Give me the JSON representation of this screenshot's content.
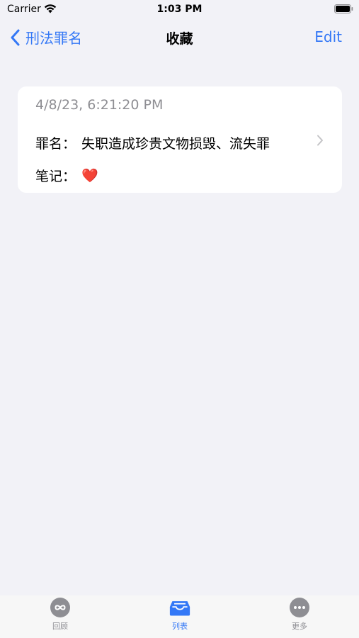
{
  "status_bar": {
    "carrier": "Carrier",
    "time": "1:03 PM",
    "icons": [
      "wifi-icon",
      "battery-icon"
    ]
  },
  "nav": {
    "back_label": "刑法罪名",
    "title": "收藏",
    "edit_label": "Edit"
  },
  "card": {
    "date": "4/8/23, 6:21:20 PM",
    "name_label": "罪名：",
    "name_value": "失职造成珍贵文物损毁、流失罪",
    "note_label": "笔记：",
    "note_value": "❤️"
  },
  "tabs": [
    {
      "label": "回顾",
      "icon": "infinity-icon",
      "active": false
    },
    {
      "label": "列表",
      "icon": "tray-icon",
      "active": true
    },
    {
      "label": "更多",
      "icon": "ellipsis-icon",
      "active": false
    }
  ],
  "colors": {
    "accent": "#3478f6",
    "background": "#f2f2f7",
    "secondary_text": "#8e8e93",
    "tab_inactive": "#8e8e93"
  }
}
